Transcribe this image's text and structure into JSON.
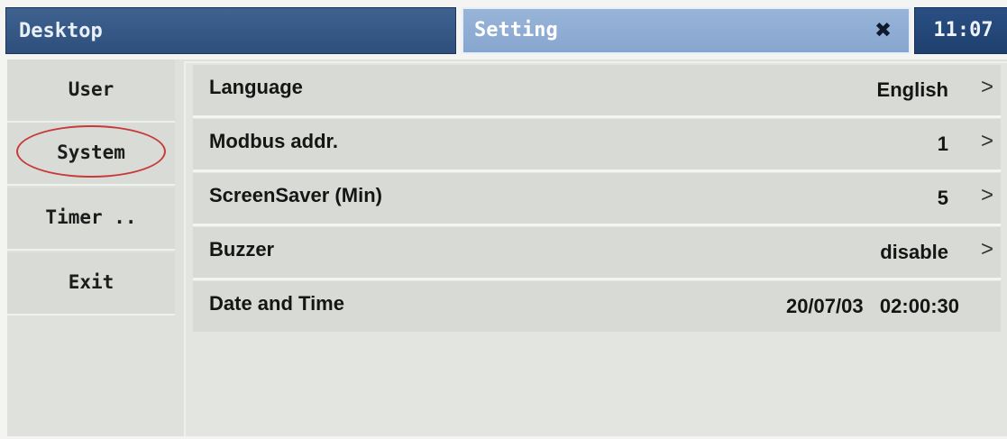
{
  "titlebar": {
    "desktop_label": "Desktop",
    "window_title": "Setting",
    "close_icon": "✖",
    "clock": "11:07"
  },
  "sidebar": {
    "items": [
      {
        "label": "User"
      },
      {
        "label": "System",
        "highlighted": true
      },
      {
        "label": "Timer .."
      },
      {
        "label": "Exit"
      }
    ],
    "highlight_color": "#c63a3a"
  },
  "settings": {
    "rows": [
      {
        "label": "Language",
        "value": "English",
        "chevron": ">"
      },
      {
        "label": "Modbus addr.",
        "value": "1",
        "chevron": ">"
      },
      {
        "label": "ScreenSaver (Min)",
        "value": "5",
        "chevron": ">"
      },
      {
        "label": "Buzzer",
        "value": "disable",
        "chevron": ">"
      },
      {
        "label": "Date and Time",
        "value": "20/07/03   02:00:30"
      }
    ]
  },
  "colors": {
    "titlebar_dark": "#2e4f7c",
    "titlebar_light": "#87a6cf",
    "panel_bg": "#dfe1dc"
  }
}
